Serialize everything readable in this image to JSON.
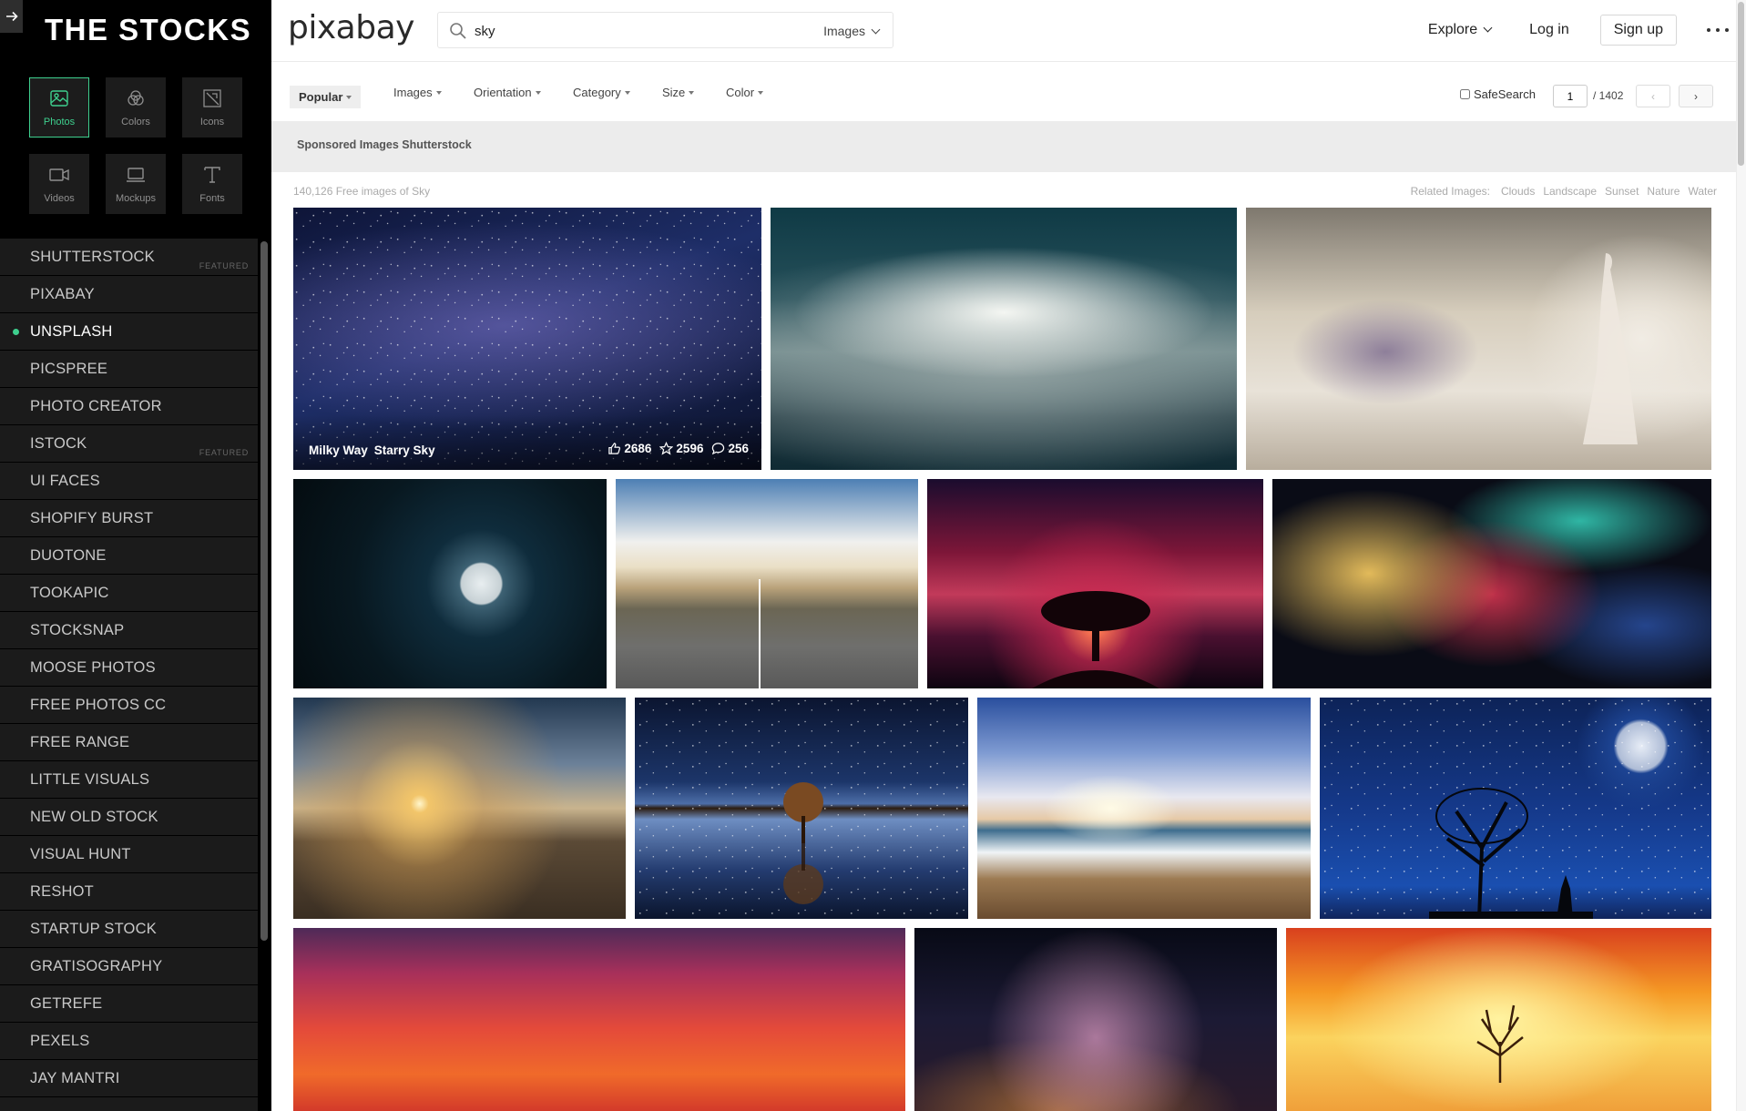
{
  "sidebar": {
    "title": "THE STOCKS",
    "tiles": [
      {
        "label": "Photos",
        "icon": "photo-icon",
        "active": true
      },
      {
        "label": "Colors",
        "icon": "palette-icon",
        "active": false
      },
      {
        "label": "Icons",
        "icon": "icons-icon",
        "active": false
      },
      {
        "label": "Videos",
        "icon": "video-icon",
        "active": false
      },
      {
        "label": "Mockups",
        "icon": "laptop-icon",
        "active": false
      },
      {
        "label": "Fonts",
        "icon": "font-icon",
        "active": false
      }
    ],
    "featured_label": "FEATURED",
    "items": [
      {
        "label": "SHUTTERSTOCK"
      },
      {
        "label": "PIXABAY"
      },
      {
        "label": "UNSPLASH"
      },
      {
        "label": "PICSPREE"
      },
      {
        "label": "PHOTO CREATOR"
      },
      {
        "label": "ISTOCK"
      },
      {
        "label": "UI FACES"
      },
      {
        "label": "SHOPIFY BURST"
      },
      {
        "label": "DUOTONE"
      },
      {
        "label": "TOOKAPIC"
      },
      {
        "label": "STOCKSNAP"
      },
      {
        "label": "MOOSE PHOTOS"
      },
      {
        "label": "FREE PHOTOS CC"
      },
      {
        "label": "FREE RANGE"
      },
      {
        "label": "LITTLE VISUALS"
      },
      {
        "label": "NEW OLD STOCK"
      },
      {
        "label": "VISUAL HUNT"
      },
      {
        "label": "RESHOT"
      },
      {
        "label": "STARTUP STOCK"
      },
      {
        "label": "GRATISOGRAPHY"
      },
      {
        "label": "GETREFE"
      },
      {
        "label": "PEXELS"
      },
      {
        "label": "JAY MANTRI"
      }
    ],
    "accent_color": "#3ecf8e"
  },
  "header": {
    "logo": "pixabay",
    "search_value": "sky",
    "search_type": "Images",
    "explore": "Explore",
    "login": "Log in",
    "signup": "Sign up"
  },
  "filters": {
    "popular": "Popular",
    "images": "Images",
    "orientation": "Orientation",
    "category": "Category",
    "size": "Size",
    "color": "Color",
    "safesearch": "SafeSearch",
    "page": "1",
    "total_pages": "/ 1402",
    "prev": "‹",
    "next": "›"
  },
  "sponsored": "Sponsored Images Shutterstock",
  "results": {
    "count": "140,126 Free images of Sky",
    "related_label": "Related Images:",
    "related": [
      "Clouds",
      "Landscape",
      "Sunset",
      "Nature",
      "Water"
    ]
  },
  "hover_photo": {
    "tags": [
      "Milky Way",
      "Starry Sky"
    ],
    "likes": "2686",
    "favorites": "2596",
    "comments": "256"
  }
}
